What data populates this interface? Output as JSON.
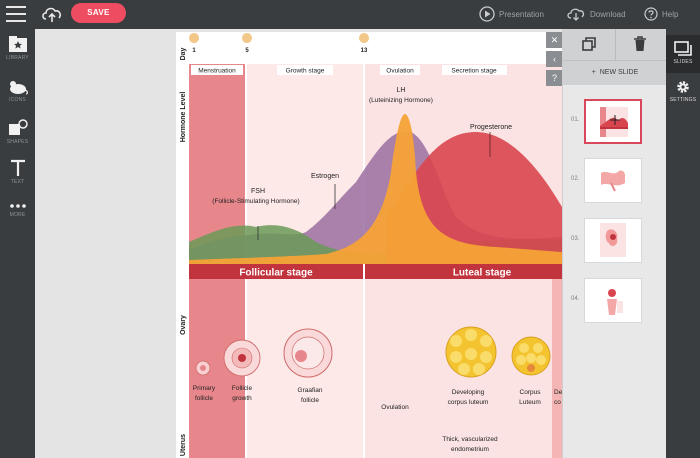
{
  "toolbar": {
    "save_label": "SAVE",
    "presentation_label": "Presentation",
    "download_label": "Download",
    "help_label": "Help"
  },
  "left_rail": {
    "items": [
      {
        "label": "LIBRARY",
        "icon": "star-folder-icon"
      },
      {
        "label": "ICONS",
        "icon": "mouse-icon"
      },
      {
        "label": "SHAPES",
        "icon": "shapes-icon"
      },
      {
        "label": "TEXT",
        "icon": "text-icon"
      },
      {
        "label": "MORE",
        "icon": "more-dots-icon"
      }
    ]
  },
  "right_rail": {
    "items": [
      {
        "label": "SLIDES",
        "icon": "slides-icon"
      },
      {
        "label": "SETTINGS",
        "icon": "gear-icon"
      }
    ]
  },
  "slides_panel": {
    "new_slide_label": "NEW SLIDE",
    "thumbnails": [
      "01.",
      "02.",
      "03.",
      "04."
    ],
    "selected": 0
  },
  "slide": {
    "axis_day": "Day",
    "axis_hormone": "Hormone Level",
    "axis_ovary": "Ovary",
    "axis_uterus": "Uterus",
    "day_markers": [
      "1",
      "5",
      "13"
    ],
    "phases": [
      "Menstruation",
      "Growth stage",
      "Ovulation",
      "Secretion stage"
    ],
    "hormones": {
      "lh": "LH",
      "lh_full": "(Luteinizing Hormone)",
      "progesterone": "Progesterone",
      "estrogen": "Estrogen",
      "fsh": "FSH",
      "fsh_full": "(Follicle-Stimulating Hormone)"
    },
    "stages": [
      "Follicular stage",
      "Luteal stage"
    ],
    "ovary_labels": {
      "primary_1": "Primary",
      "primary_2": "follicle",
      "growth_1": "Follicle",
      "growth_2": "growth",
      "graafian_1": "Graafian",
      "graafian_2": "follicle",
      "ovulation": "Ovulation",
      "developing_1": "Developing",
      "developing_2": "corpus luteum",
      "corpus_1": "Corpus",
      "corpus_2": "Luteum",
      "cut_1": "De",
      "cut_2": "co"
    },
    "uterus_labels": {
      "thick_1": "Thick, vascularized",
      "thick_2": "endometrium"
    }
  },
  "colors": {
    "accent": "#ee4d61",
    "chrome": "#3a3d40",
    "menstruation": "#e7878b",
    "stage_bar": "#c1333d",
    "lh": "#f5a236",
    "progesterone": "#d9454e",
    "estrogen": "#9a6ea0",
    "fsh": "#6b9a57"
  }
}
